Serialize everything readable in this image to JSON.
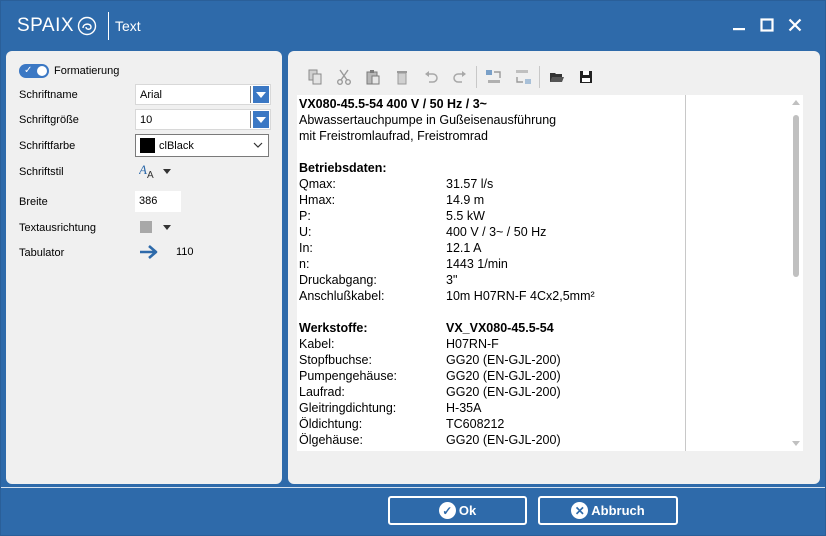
{
  "window": {
    "logo_text": "SPAIX",
    "title": "Text"
  },
  "format_panel": {
    "toggle_label": "Formatierung",
    "labels": {
      "font_name": "Schriftname",
      "font_size": "Schriftgröße",
      "font_color": "Schriftfarbe",
      "font_style": "Schriftstil",
      "width": "Breite",
      "text_align": "Textausrichtung",
      "tabulator": "Tabulator"
    },
    "values": {
      "font_name": "Arial",
      "font_size": "10",
      "font_color": "clBlack",
      "width": "386",
      "tabulator": "110"
    }
  },
  "toolbar": {
    "buttons": [
      "copy-icon",
      "cut-icon",
      "paste-icon",
      "delete-icon",
      "undo-icon",
      "redo-icon",
      "import-icon",
      "export-icon",
      "open-folder-icon",
      "save-icon"
    ]
  },
  "editor": {
    "lines": [
      {
        "k": "VX080-45.5-54    400 V /  50 Hz / 3~",
        "v": "",
        "bold": true,
        "wide": true
      },
      {
        "k": "Abwassertauchpumpe in Gußeisenausführung",
        "v": "",
        "bold": false,
        "wide": true
      },
      {
        "k": "mit Freistromlaufrad, Freistromrad",
        "v": "",
        "bold": false,
        "wide": true
      },
      {
        "k": "",
        "v": "",
        "bold": false,
        "wide": true
      },
      {
        "k": "Betriebsdaten:",
        "v": "",
        "bold": true,
        "wide": true
      },
      {
        "k": "Qmax:",
        "v": "31.57 l/s",
        "bold": false
      },
      {
        "k": "Hmax:",
        "v": "14.9 m",
        "bold": false
      },
      {
        "k": "P:",
        "v": "5.5 kW",
        "bold": false
      },
      {
        "k": "U:",
        "v": "400 V / 3~ / 50 Hz",
        "bold": false
      },
      {
        "k": "In:",
        "v": "12.1 A",
        "bold": false
      },
      {
        "k": "n:",
        "v": "1443 1/min",
        "bold": false
      },
      {
        "k": "Druckabgang:",
        "v": "3\"",
        "bold": false
      },
      {
        "k": "Anschlußkabel:",
        "v": "10m H07RN-F 4Cx2,5mm²",
        "bold": false
      },
      {
        "k": "",
        "v": "",
        "bold": false,
        "wide": true
      },
      {
        "k": "Werkstoffe:",
        "v": "VX_VX080-45.5-54",
        "bold": true
      },
      {
        "k": "Kabel:",
        "v": "H07RN-F",
        "bold": false
      },
      {
        "k": "Stopfbuchse:",
        "v": "GG20 (EN-GJL-200)",
        "bold": false
      },
      {
        "k": "Pumpengehäuse:",
        "v": "GG20 (EN-GJL-200)",
        "bold": false
      },
      {
        "k": "Laufrad:",
        "v": "GG20 (EN-GJL-200)",
        "bold": false
      },
      {
        "k": "Gleitringdichtung:",
        "v": "H-35A",
        "bold": false
      },
      {
        "k": "Öldichtung:",
        "v": "TC608212",
        "bold": false
      },
      {
        "k": "Ölgehäuse:",
        "v": "GG20 (EN-GJL-200)",
        "bold": false
      }
    ]
  },
  "footer": {
    "ok_label": "Ok",
    "cancel_label": "Abbruch"
  },
  "colors": {
    "accent": "#2e6aaa",
    "toggle": "#3b78c4"
  }
}
